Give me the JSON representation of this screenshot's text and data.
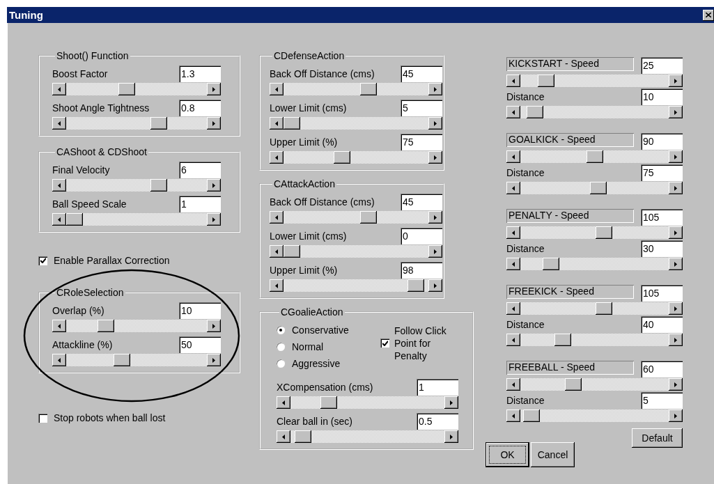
{
  "window": {
    "title": "Tuning"
  },
  "left_column": [
    {
      "kind": "group",
      "title": "Shoot() Function",
      "rows": [
        {
          "label": "Boost Factor",
          "value": "1.3",
          "level": 0.42
        },
        {
          "label": "Shoot Angle Tightness",
          "value": "0.8",
          "level": 0.68
        }
      ]
    },
    {
      "kind": "group",
      "title": "CAShoot & CDShoot",
      "rows": [
        {
          "label": "Final Velocity",
          "value": "6",
          "level": 0.68
        },
        {
          "label": "Ball Speed Scale",
          "value": "1",
          "level": 0.0
        }
      ]
    },
    {
      "kind": "checkbox",
      "label": "Enable Parallax Correction",
      "checked": true
    },
    {
      "kind": "group",
      "title": "CRoleSelection",
      "rows": [
        {
          "label": "Overlap (%)",
          "value": "10",
          "level": 0.25
        },
        {
          "label": "Attackline (%)",
          "value": "50",
          "level": 0.38
        }
      ]
    },
    {
      "kind": "checkbox",
      "label": "Stop robots when ball lost",
      "checked": false
    }
  ],
  "middle_groups": [
    {
      "title": "CDefenseAction",
      "rows": [
        {
          "label": "Back Off Distance (cms)",
          "value": "45",
          "level": 0.6
        },
        {
          "label": "Lower Limit (cms)",
          "value": "5",
          "level": 0.0
        },
        {
          "label": "Upper Limit (%)",
          "value": "75",
          "level": 0.39
        }
      ]
    },
    {
      "title": "CAttackAction",
      "rows": [
        {
          "label": "Back Off Distance (cms)",
          "value": "45",
          "level": 0.6
        },
        {
          "label": "Lower Limit (cms)",
          "value": "0",
          "level": 0.0
        },
        {
          "label": "Upper Limit (%)",
          "value": "98",
          "level": 0.97
        }
      ]
    }
  ],
  "goalie": {
    "title": "CGoalieAction",
    "modes": [
      {
        "label": "Conservative",
        "selected": true
      },
      {
        "label": "Normal",
        "selected": false
      },
      {
        "label": "Aggressive",
        "selected": false
      }
    ],
    "follow": {
      "label": "Follow Click Point for Penalty",
      "checked": true
    },
    "rows": [
      {
        "label": "XCompensation (cms)",
        "value": "1",
        "level": 0.22
      },
      {
        "label": "Clear ball in (sec)",
        "value": "0.5",
        "level": 0.03
      }
    ]
  },
  "kicks": [
    {
      "speed": {
        "label": "KICKSTART - Speed",
        "value": "25",
        "level": 0.13
      },
      "distance": {
        "label": "Distance",
        "value": "10",
        "level": 0.05
      }
    },
    {
      "speed": {
        "label": "GOALKICK - Speed",
        "value": "90",
        "level": 0.5
      },
      "distance": {
        "label": "Distance",
        "value": "75",
        "level": 0.53
      }
    },
    {
      "speed": {
        "label": "PENALTY - Speed",
        "value": "105",
        "level": 0.57
      },
      "distance": {
        "label": "Distance",
        "value": "30",
        "level": 0.17
      }
    },
    {
      "speed": {
        "label": "FREEKICK - Speed",
        "value": "105",
        "level": 0.57
      },
      "distance": {
        "label": "Distance",
        "value": "40",
        "level": 0.26
      }
    },
    {
      "speed": {
        "label": "FREEBALL - Speed",
        "value": "60",
        "level": 0.34
      },
      "distance": {
        "label": "Distance",
        "value": "5",
        "level": 0.02
      }
    }
  ],
  "buttons": {
    "default": "Default",
    "ok": "OK",
    "cancel": "Cancel"
  }
}
